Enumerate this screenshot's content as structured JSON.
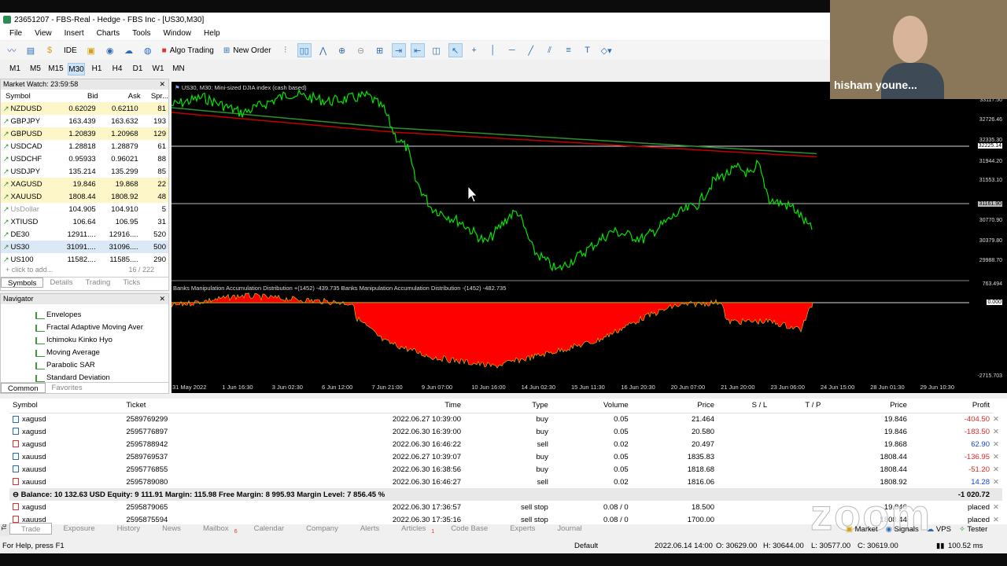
{
  "window": {
    "title": "23651207 - FBS-Real - Hedge - FBS Inc - [US30,M30]"
  },
  "menu": [
    "File",
    "View",
    "Insert",
    "Charts",
    "Tools",
    "Window",
    "Help"
  ],
  "toolbar": {
    "ide": "IDE",
    "algo_trading": "Algo Trading",
    "new_order": "New Order"
  },
  "timeframes": [
    "M1",
    "M5",
    "M15",
    "M30",
    "H1",
    "H4",
    "D1",
    "W1",
    "MN"
  ],
  "selected_timeframe": "M30",
  "market_watch": {
    "title": "Market Watch: 23:59:58",
    "headers": [
      "Symbol",
      "Bid",
      "Ask",
      "Spr..."
    ],
    "rows": [
      {
        "symbol": "NZDUSD",
        "bid": "0.62029",
        "ask": "0.62110",
        "spread": "81",
        "tint": "yellow"
      },
      {
        "symbol": "GBPJPY",
        "bid": "163.439",
        "ask": "163.632",
        "spread": "193",
        "tint": "none"
      },
      {
        "symbol": "GBPUSD",
        "bid": "1.20839",
        "ask": "1.20968",
        "spread": "129",
        "tint": "yellow"
      },
      {
        "symbol": "USDCAD",
        "bid": "1.28818",
        "ask": "1.28879",
        "spread": "61",
        "tint": "none"
      },
      {
        "symbol": "USDCHF",
        "bid": "0.95933",
        "ask": "0.96021",
        "spread": "88",
        "tint": "none"
      },
      {
        "symbol": "USDJPY",
        "bid": "135.214",
        "ask": "135.299",
        "spread": "85",
        "tint": "none"
      },
      {
        "symbol": "XAGUSD",
        "bid": "19.846",
        "ask": "19.868",
        "spread": "22",
        "tint": "yellow"
      },
      {
        "symbol": "XAUUSD",
        "bid": "1808.44",
        "ask": "1808.92",
        "spread": "48",
        "tint": "yellow"
      },
      {
        "symbol": "UsDollar",
        "bid": "104.905",
        "ask": "104.910",
        "spread": "5",
        "tint": "gray"
      },
      {
        "symbol": "XTIUSD",
        "bid": "106.64",
        "ask": "106.95",
        "spread": "31",
        "tint": "none"
      },
      {
        "symbol": "DE30",
        "bid": "12911....",
        "ask": "12916....",
        "spread": "520",
        "tint": "none"
      },
      {
        "symbol": "US30",
        "bid": "31091....",
        "ask": "31096....",
        "spread": "500",
        "tint": "blue"
      },
      {
        "symbol": "US100",
        "bid": "11582....",
        "ask": "11585....",
        "spread": "290",
        "tint": "none"
      }
    ],
    "add_text": "click to add...",
    "count": "16 / 222",
    "tabs": [
      "Symbols",
      "Details",
      "Trading",
      "Ticks"
    ]
  },
  "navigator": {
    "title": "Navigator",
    "items": [
      "Envelopes",
      "Fractal Adaptive Moving Aver",
      "Ichimoku Kinko Hyo",
      "Moving Average",
      "Parabolic SAR",
      "Standard Deviation"
    ],
    "tabs": [
      "Common",
      "Favorites"
    ]
  },
  "chart": {
    "title": "US30, M30:  Mini-sized DJIA index (cash based)",
    "indicator_title": "Banks Manipulation Accumulation Distribution +(1452) -439.735 Banks Manipulation Accumulation Distribution -(1452) -482.735",
    "price_axis": [
      "33117.50",
      "32726.46",
      "32335.30",
      "32225.14",
      "31944.20",
      "31553.10",
      "31161.90",
      "30770.90",
      "30379.80",
      "29988.70"
    ],
    "indicator_axis": [
      "763.494",
      "0.000",
      "-2715.703"
    ],
    "time_axis": [
      "31 May 2022",
      "1 Jun 16:30",
      "3 Jun 02:30",
      "6 Jun 12:00",
      "7 Jun 21:00",
      "9 Jun 07:00",
      "10 Jun 16:00",
      "14 Jun 02:30",
      "15 Jun 11:30",
      "16 Jun 20:30",
      "20 Jun 07:00",
      "21 Jun 20:00",
      "23 Jun 06:00",
      "24 Jun 15:00",
      "28 Jun 01:30",
      "29 Jun 10:30"
    ]
  },
  "webcam": {
    "name": "hisham youne..."
  },
  "terminal": {
    "headers": [
      "Symbol",
      "Ticket",
      "Time",
      "Type",
      "Volume",
      "Price",
      "S / L",
      "T / P",
      "Price",
      "Profit"
    ],
    "positions": [
      {
        "symbol": "xagusd",
        "ticket": "2589769299",
        "time": "2022.06.27 10:39:00",
        "type": "buy",
        "volume": "0.05",
        "price": "21.464",
        "sl": "",
        "tp": "",
        "cur": "19.846",
        "profit": "-404.50",
        "sign": "loss"
      },
      {
        "symbol": "xagusd",
        "ticket": "2595776897",
        "time": "2022.06.30 16:39:00",
        "type": "buy",
        "volume": "0.05",
        "price": "20.580",
        "sl": "",
        "tp": "",
        "cur": "19.846",
        "profit": "-183.50",
        "sign": "loss"
      },
      {
        "symbol": "xagusd",
        "ticket": "2595788942",
        "time": "2022.06.30 16:46:22",
        "type": "sell",
        "volume": "0.02",
        "price": "20.497",
        "sl": "",
        "tp": "",
        "cur": "19.868",
        "profit": "62.90",
        "sign": "win"
      },
      {
        "symbol": "xauusd",
        "ticket": "2589769537",
        "time": "2022.06.27 10:39:07",
        "type": "buy",
        "volume": "0.05",
        "price": "1835.83",
        "sl": "",
        "tp": "",
        "cur": "1808.44",
        "profit": "-136.95",
        "sign": "loss"
      },
      {
        "symbol": "xauusd",
        "ticket": "2595776855",
        "time": "2022.06.30 16:38:56",
        "type": "buy",
        "volume": "0.05",
        "price": "1818.68",
        "sl": "",
        "tp": "",
        "cur": "1808.44",
        "profit": "-51.20",
        "sign": "loss"
      },
      {
        "symbol": "xauusd",
        "ticket": "2595789080",
        "time": "2022.06.30 16:46:27",
        "type": "sell",
        "volume": "0.02",
        "price": "1816.06",
        "sl": "",
        "tp": "",
        "cur": "1808.92",
        "profit": "14.28",
        "sign": "win"
      }
    ],
    "balance_line": "Balance: 10 132.63 USD  Equity: 9 111.91  Margin: 115.98  Free Margin: 8 995.93  Margin Level: 7 856.45 %",
    "balance_profit": "-1 020.72",
    "orders": [
      {
        "symbol": "xagusd",
        "ticket": "2595879065",
        "time": "2022.06.30 17:36:57",
        "type": "sell stop",
        "volume": "0.08 / 0",
        "price": "18.500",
        "cur": "19.846",
        "state": "placed"
      },
      {
        "symbol": "xauusd",
        "ticket": "2595875594",
        "time": "2022.06.30 17:35:16",
        "type": "sell stop",
        "volume": "0.08 / 0",
        "price": "1700.00",
        "cur": "1808.44",
        "state": "placed"
      }
    ],
    "tabs": [
      "Trade",
      "Exposure",
      "History",
      "News",
      "Mailbox",
      "Calendar",
      "Company",
      "Alerts",
      "Articles",
      "Code Base",
      "Experts",
      "Journal"
    ],
    "mailbox_count": "6",
    "articles_count": "1"
  },
  "toolbox_label": "Toolbox",
  "status": {
    "help": "For Help, press F1",
    "profile": "Default",
    "datetime": "2022.06.14 14:00",
    "open": "O: 30629.00",
    "high": "H: 30644.00",
    "low": "L: 30577.00",
    "close": "C: 30619.00",
    "market": "Market",
    "signals": "Signals",
    "vps": "VPS",
    "tester": "Tester",
    "ping": "100.52 ms"
  },
  "watermark": "zoom",
  "colors": {
    "bull": "#00e600",
    "indicator": "#ff0000",
    "ma1": "#2f8f2f",
    "ma2": "#c00000",
    "loss": "#e02a2a",
    "win": "#1a3fd6"
  }
}
